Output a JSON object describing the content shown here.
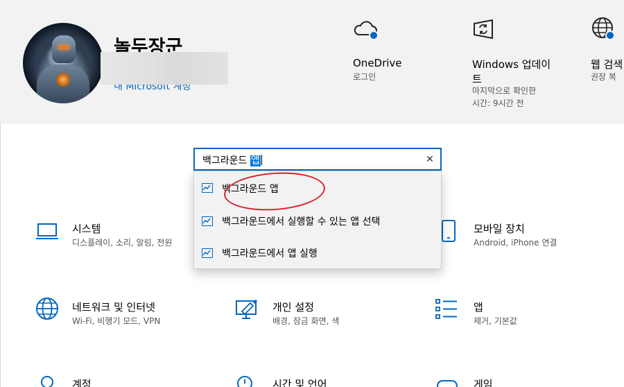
{
  "header": {
    "user_name": "놀두장군",
    "account_link": "내 Microsoft 계정",
    "onedrive": {
      "title": "OneDrive",
      "sub": "로그인"
    },
    "windows_update": {
      "title_line1": "Windows 업데이",
      "title_line2": "트",
      "sub_line1": "마지막으로 확인한",
      "sub_line2": "시간: 9시간 전"
    },
    "web_search": {
      "title": "웹 검색",
      "sub": "권장 복"
    }
  },
  "search": {
    "text": "백그라운드 ",
    "selected": "앱",
    "clear_icon": "close-icon"
  },
  "suggestions": [
    {
      "label": "백그라운드 앱"
    },
    {
      "label": "백그라운드에서 실행할 수 있는 앱 선택"
    },
    {
      "label": "백그라운드에서 앱 실행"
    }
  ],
  "tiles": {
    "system": {
      "title": "시스템",
      "desc": "디스플레이, 소리, 알림, 전원"
    },
    "mobile": {
      "title": "모바일 장치",
      "desc": "Android, iPhone 연결"
    },
    "network": {
      "title": "네트워크 및 인터넷",
      "desc": "Wi-Fi, 비행기 모드, VPN"
    },
    "personalization": {
      "title": "개인 설정",
      "desc": "배경, 잠금 화면, 색"
    },
    "apps": {
      "title": "앱",
      "desc": "제거, 기본값"
    },
    "accounts": {
      "title": "계정"
    },
    "time_language": {
      "title": "시간 및 언어"
    },
    "gaming": {
      "title": "게임"
    }
  },
  "colors": {
    "accent": "#0067c0",
    "header_bg": "#f2f2f2",
    "annotation": "#d6202e"
  }
}
